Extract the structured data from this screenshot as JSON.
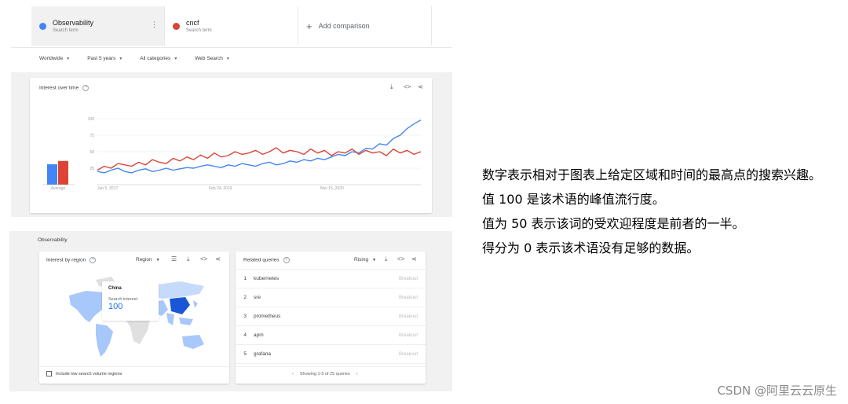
{
  "terms": [
    {
      "name": "Observability",
      "sub": "Search term",
      "color": "#4285f4"
    },
    {
      "name": "cncf",
      "sub": "Search term",
      "color": "#db4437"
    }
  ],
  "add_comparison": "Add comparison",
  "filters": [
    "Worldwide",
    "Past 5 years",
    "All categories",
    "Web Search"
  ],
  "interest": {
    "title": "Interest over time",
    "average_label": "Average",
    "y_ticks": [
      "100",
      "75",
      "50",
      "25"
    ],
    "x_ticks": [
      "Jun 5, 2017",
      "Feb 24, 2019",
      "Nov 15, 2020"
    ]
  },
  "chart_data": {
    "type": "line",
    "title": "Interest over time",
    "x_ticks": [
      "Jun 5, 2017",
      "Feb 24, 2019",
      "Nov 15, 2020"
    ],
    "ylim": [
      0,
      100
    ],
    "series": [
      {
        "name": "Observability",
        "color": "#4285f4",
        "average": 31,
        "values": [
          20,
          18,
          22,
          25,
          20,
          18,
          22,
          24,
          20,
          22,
          25,
          22,
          24,
          26,
          25,
          28,
          30,
          28,
          26,
          30,
          28,
          32,
          30,
          28,
          32,
          34,
          30,
          32,
          36,
          34,
          38,
          36,
          40,
          38,
          42,
          46,
          44,
          50,
          48,
          55,
          54,
          62,
          60,
          70,
          75,
          85,
          92,
          98
        ]
      },
      {
        "name": "cncf",
        "color": "#db4437",
        "average": 36,
        "values": [
          22,
          28,
          25,
          32,
          30,
          28,
          34,
          30,
          38,
          34,
          32,
          40,
          36,
          42,
          38,
          45,
          40,
          48,
          42,
          44,
          50,
          46,
          48,
          52,
          46,
          50,
          56,
          48,
          52,
          50,
          46,
          54,
          48,
          52,
          44,
          50,
          48,
          54,
          46,
          52,
          48,
          50,
          44,
          54,
          48,
          52,
          46,
          50
        ]
      }
    ]
  },
  "observability_label": "Observability",
  "region": {
    "title": "Interest by region",
    "dropdown": "Region",
    "tooltip_country": "China",
    "tooltip_label": "Search interest",
    "tooltip_value": "100",
    "checkbox_label": "Include low search volume regions"
  },
  "related": {
    "title": "Related queries",
    "dropdown": "Rising",
    "rows": [
      {
        "n": "1",
        "q": "kubernetes",
        "b": "Breakout"
      },
      {
        "n": "2",
        "q": "sre",
        "b": "Breakout"
      },
      {
        "n": "3",
        "q": "prometheus",
        "b": "Breakout"
      },
      {
        "n": "4",
        "q": "apm",
        "b": "Breakout"
      },
      {
        "n": "5",
        "q": "grafana",
        "b": "Breakout"
      }
    ],
    "pager": "Showing 1-5 of 25 queries"
  },
  "notes": [
    "数字表示相对于图表上给定区域和时间的最高点的搜索兴趣。",
    "值 100 是该术语的峰值流行度。",
    "值为 50 表示该词的受欢迎程度是前者的一半。",
    "得分为 0 表示该术语没有足够的数据。"
  ],
  "watermark": "CSDN @阿里云云原生"
}
